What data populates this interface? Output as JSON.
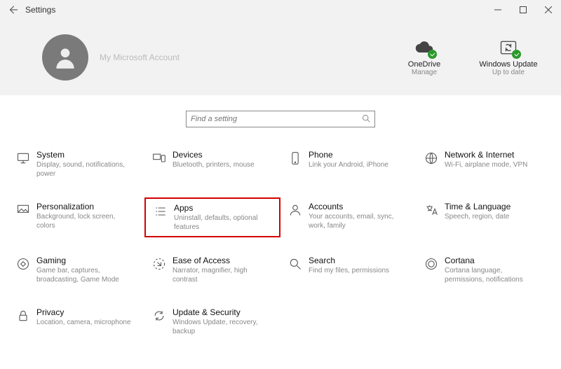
{
  "window": {
    "title": "Settings"
  },
  "account": {
    "name": "My Microsoft Account"
  },
  "status": {
    "onedrive": {
      "title": "OneDrive",
      "sub": "Manage"
    },
    "update": {
      "title": "Windows Update",
      "sub": "Up to date"
    }
  },
  "search": {
    "placeholder": "Find a setting"
  },
  "tiles": {
    "system": {
      "title": "System",
      "sub": "Display, sound, notifications, power"
    },
    "devices": {
      "title": "Devices",
      "sub": "Bluetooth, printers, mouse"
    },
    "phone": {
      "title": "Phone",
      "sub": "Link your Android, iPhone"
    },
    "network": {
      "title": "Network & Internet",
      "sub": "Wi-Fi, airplane mode, VPN"
    },
    "personalization": {
      "title": "Personalization",
      "sub": "Background, lock screen, colors"
    },
    "apps": {
      "title": "Apps",
      "sub": "Uninstall, defaults, optional features"
    },
    "accounts": {
      "title": "Accounts",
      "sub": "Your accounts, email, sync, work, family"
    },
    "time": {
      "title": "Time & Language",
      "sub": "Speech, region, date"
    },
    "gaming": {
      "title": "Gaming",
      "sub": "Game bar, captures, broadcasting, Game Mode"
    },
    "ease": {
      "title": "Ease of Access",
      "sub": "Narrator, magnifier, high contrast"
    },
    "search_tile": {
      "title": "Search",
      "sub": "Find my files, permissions"
    },
    "cortana": {
      "title": "Cortana",
      "sub": "Cortana language, permissions, notifications"
    },
    "privacy": {
      "title": "Privacy",
      "sub": "Location, camera, microphone"
    },
    "update": {
      "title": "Update & Security",
      "sub": "Windows Update, recovery, backup"
    }
  }
}
